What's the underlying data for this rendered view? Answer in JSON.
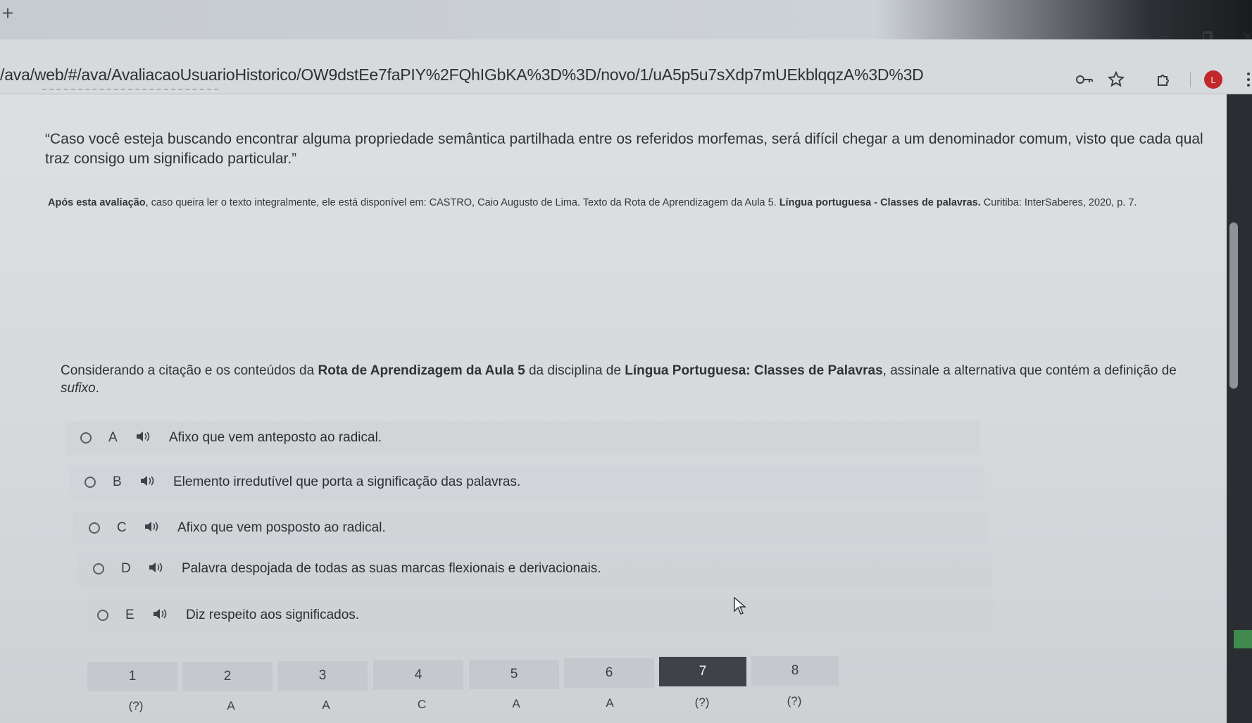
{
  "browser": {
    "new_tab_glyph": "+",
    "url": "/ava/web/#/ava/AvaliacaoUsuarioHistorico/OW9dstEe7faPIY%2FQhIGbKA%3D%3D/novo/1/uA5p5u7sXdp7mUEkblqqzA%3D%3D",
    "profile_initial": "L"
  },
  "content": {
    "quote": "“Caso você esteja buscando encontrar alguma propriedade semântica partilhada entre os referidos morfemas, será difícil chegar a um denominador comum, visto que cada qual traz consigo um significado particular.”",
    "reference": {
      "lead": "Após esta avaliação",
      "text1": ", caso queira ler o texto integralmente, ele está disponível em: CASTRO, Caio Augusto de Lima.  Texto da Rota de Aprendizagem da Aula 5. ",
      "book": "Língua portuguesa - Classes de palavras.",
      "text2": " Curitiba: InterSaberes, 2020, p. 7."
    },
    "question": {
      "p1": "Considerando a citação e os conteúdos da ",
      "b1": "Rota de Aprendizagem da Aula 5",
      "p2": " da disciplina de ",
      "b2": "Língua Portuguesa: Classes de Palavras",
      "p3": ", assinale a alternativa que contém a definição de ",
      "i1": "sufixo",
      "p4": "."
    },
    "options": [
      {
        "letter": "A",
        "text": "Afixo que vem anteposto ao radical."
      },
      {
        "letter": "B",
        "text": "Elemento irredutível que porta a significação das palavras."
      },
      {
        "letter": "C",
        "text": "Afixo que vem posposto ao radical."
      },
      {
        "letter": "D",
        "text": "Palavra despojada de todas as suas marcas flexionais e derivacionais."
      },
      {
        "letter": "E",
        "text": "Diz respeito aos significados."
      }
    ]
  },
  "navigator": {
    "current": 7,
    "items": [
      {
        "num": "1",
        "answer": "(?)"
      },
      {
        "num": "2",
        "answer": "A"
      },
      {
        "num": "3",
        "answer": "A"
      },
      {
        "num": "4",
        "answer": "C"
      },
      {
        "num": "5",
        "answer": "A"
      },
      {
        "num": "6",
        "answer": "A"
      },
      {
        "num": "7",
        "answer": "(?)"
      },
      {
        "num": "8",
        "answer": "(?)"
      }
    ]
  }
}
